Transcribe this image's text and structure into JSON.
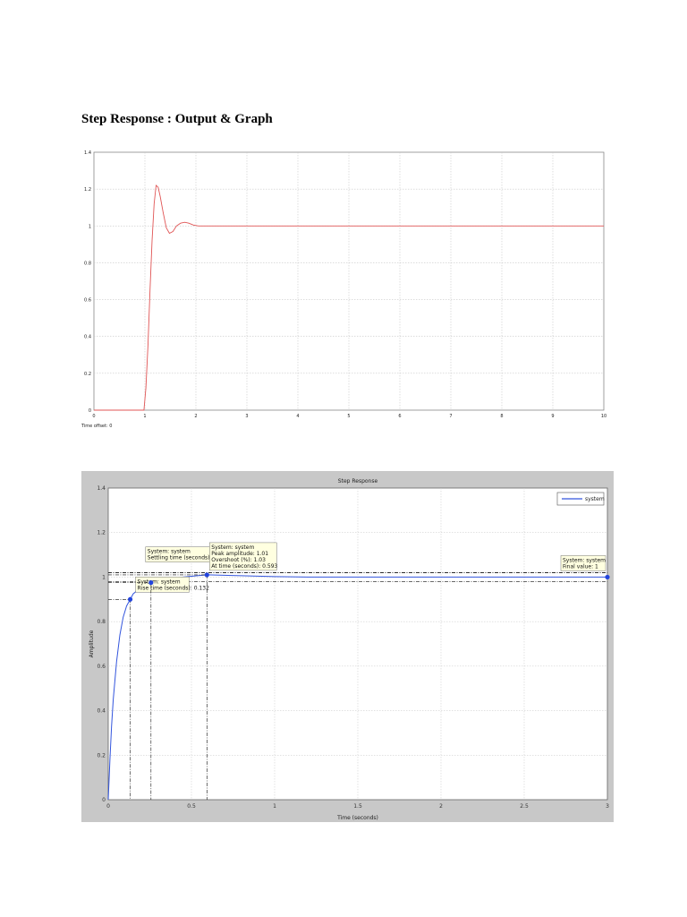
{
  "page": {
    "heading": "Step Response : Output & Graph"
  },
  "chart_data": [
    {
      "type": "line",
      "title": "",
      "xlabel": "",
      "ylabel": "",
      "footer_label": "Time offset:  0",
      "xlim": [
        0,
        10
      ],
      "ylim": [
        0,
        1.4
      ],
      "grid": true,
      "xticks": [
        "0",
        "1",
        "2",
        "3",
        "4",
        "5",
        "6",
        "7",
        "8",
        "9",
        "10"
      ],
      "yticks": [
        "0",
        "0.2",
        "0.4",
        "0.6",
        "0.8",
        "1",
        "1.2",
        "1.4"
      ],
      "line_color": "#e05555",
      "series": [
        {
          "x": [
            0,
            0.98,
            1.02,
            1.06,
            1.1,
            1.14,
            1.18,
            1.22,
            1.26,
            1.3,
            1.36,
            1.42,
            1.48,
            1.55,
            1.62,
            1.7,
            1.78,
            1.86,
            1.95,
            2.05,
            2.2,
            2.6,
            3,
            10
          ],
          "y": [
            0,
            0,
            0.12,
            0.35,
            0.65,
            0.92,
            1.12,
            1.22,
            1.21,
            1.16,
            1.07,
            0.99,
            0.96,
            0.97,
            1.0,
            1.015,
            1.02,
            1.015,
            1.005,
            1.0,
            1.0,
            1.0,
            1.0,
            1.0
          ]
        }
      ]
    },
    {
      "type": "line",
      "title": "Step Response",
      "xlabel": "Time (seconds)",
      "ylabel": "Amplitude",
      "xlim": [
        0,
        3
      ],
      "ylim": [
        0,
        1.4
      ],
      "grid": true,
      "legend_position": "top-right",
      "xticks": [
        "0",
        "0.5",
        "1",
        "1.5",
        "2",
        "2.5",
        "3"
      ],
      "yticks": [
        "0",
        "0.2",
        "0.4",
        "0.6",
        "0.8",
        "1",
        "1.2",
        "1.4"
      ],
      "line_color": "#3355dd",
      "series": [
        {
          "name": "system",
          "x": [
            0,
            0.01,
            0.02,
            0.03,
            0.05,
            0.07,
            0.09,
            0.11,
            0.132,
            0.15,
            0.2,
            0.257,
            0.35,
            0.45,
            0.593,
            0.8,
            1.0,
            1.2,
            1.5,
            2.0,
            3.0
          ],
          "y": [
            0,
            0.18,
            0.33,
            0.45,
            0.62,
            0.74,
            0.82,
            0.87,
            0.9,
            0.925,
            0.955,
            0.975,
            0.99,
            1.0,
            1.01,
            1.006,
            1.002,
            1.0,
            1.0,
            1.0,
            1.0
          ]
        }
      ],
      "annotations": [
        {
          "x": 0.132,
          "y": 0.9,
          "lines": [
            "System: system",
            "Rise time (seconds): 0.132"
          ]
        },
        {
          "x": 0.257,
          "y": 0.975,
          "lines": [
            "System: system",
            "Settling time (seconds): 0.257"
          ]
        },
        {
          "x": 0.593,
          "y": 1.01,
          "lines": [
            "System: system",
            "Peak amplitude: 1.01",
            "Overshoot (%): 1.03",
            "At time (seconds): 0.593"
          ]
        },
        {
          "x": 3.0,
          "y": 1.0,
          "lines": [
            "System: system",
            "Final value: 1"
          ]
        }
      ]
    }
  ]
}
